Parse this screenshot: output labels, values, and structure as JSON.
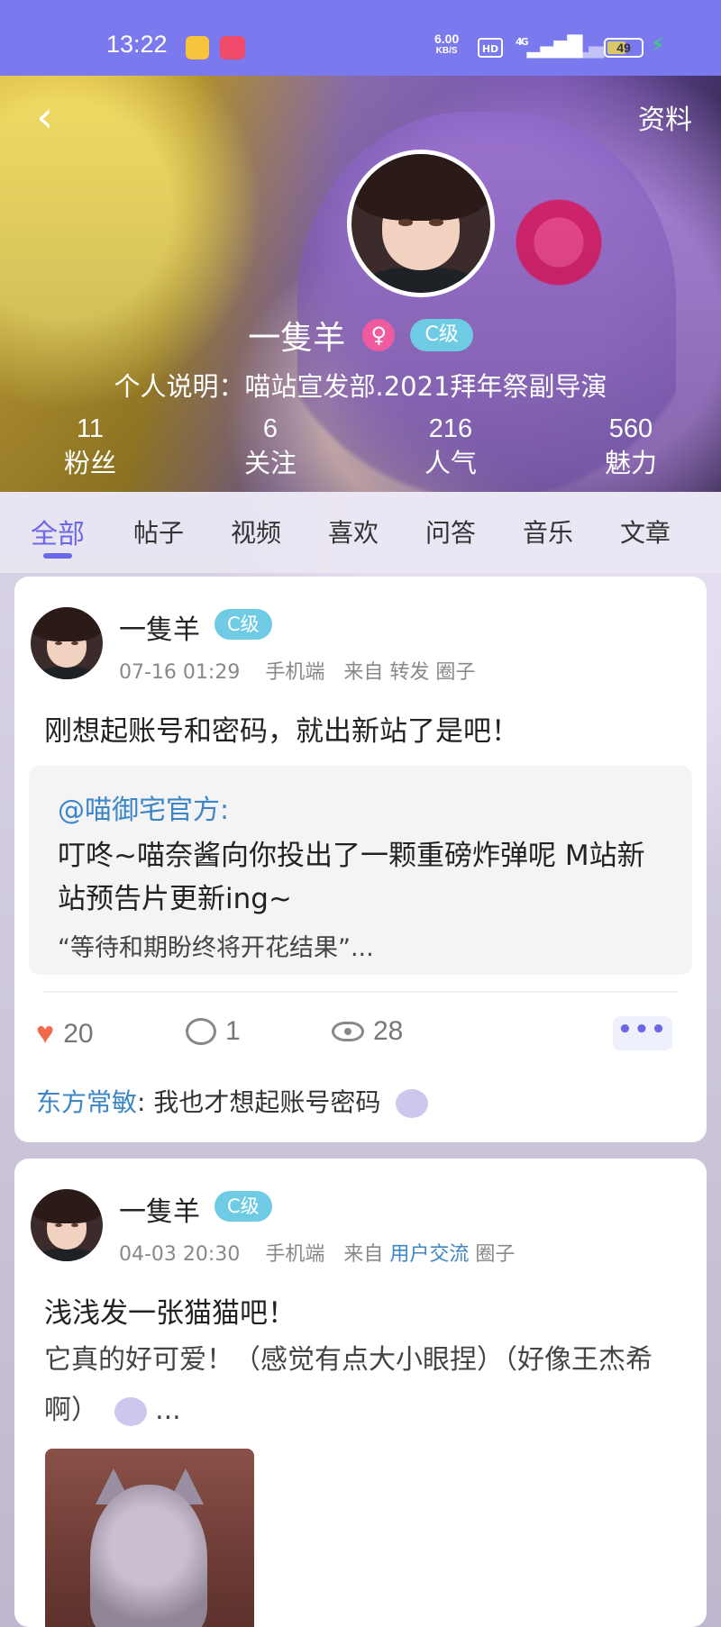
{
  "status_bar": {
    "time": "13:22",
    "speed_value": "6.00",
    "speed_unit": "KB/S",
    "hd_label": "HD",
    "network_label": "4G",
    "battery_level": "49",
    "accent_color": "#7b79ee"
  },
  "header": {
    "back_icon": "chevron-left-icon",
    "profile_link": "资料",
    "username": "一隻羊",
    "gender_symbol": "♀",
    "level": "C级",
    "bio": "个人说明：喵站宣发部.2021拜年祭副导演",
    "stats": [
      {
        "value": "11",
        "label": "粉丝"
      },
      {
        "value": "6",
        "label": "关注"
      },
      {
        "value": "216",
        "label": "人气"
      },
      {
        "value": "560",
        "label": "魅力"
      }
    ]
  },
  "tabs": [
    "全部",
    "帖子",
    "视频",
    "喜欢",
    "问答",
    "音乐",
    "文章"
  ],
  "active_tab": "全部",
  "posts": [
    {
      "author": "一隻羊",
      "level": "C级",
      "date": "07-16 01:29",
      "device": "手机端",
      "from_label": "来自",
      "source": "转发",
      "circle_label": "圈子",
      "text": "刚想起账号和密码，就出新站了是吧！",
      "quote": {
        "author": "@喵御宅官方:",
        "text": "叮咚~喵奈酱向你投出了一颗重磅炸弹呢 M站新站预告片更新ing~",
        "sub": "“等待和期盼终将开花结果”..."
      },
      "likes": "20",
      "comments": "1",
      "views": "28",
      "more_label": "•••",
      "top_comment": {
        "user": "东方常敏",
        "sep": ":",
        "text": "我也才想起账号密码"
      }
    },
    {
      "author": "一隻羊",
      "level": "C级",
      "date": "04-03 20:30",
      "device": "手机端",
      "from_label": "来自",
      "source": "用户交流",
      "circle_label": "圈子",
      "title": "浅浅发一张猫猫吧！",
      "body": "它真的好可爱！（感觉有点大小眼捏）（好像王杰希啊）",
      "body_suffix": " ...",
      "photo_subject": "cat"
    }
  ]
}
